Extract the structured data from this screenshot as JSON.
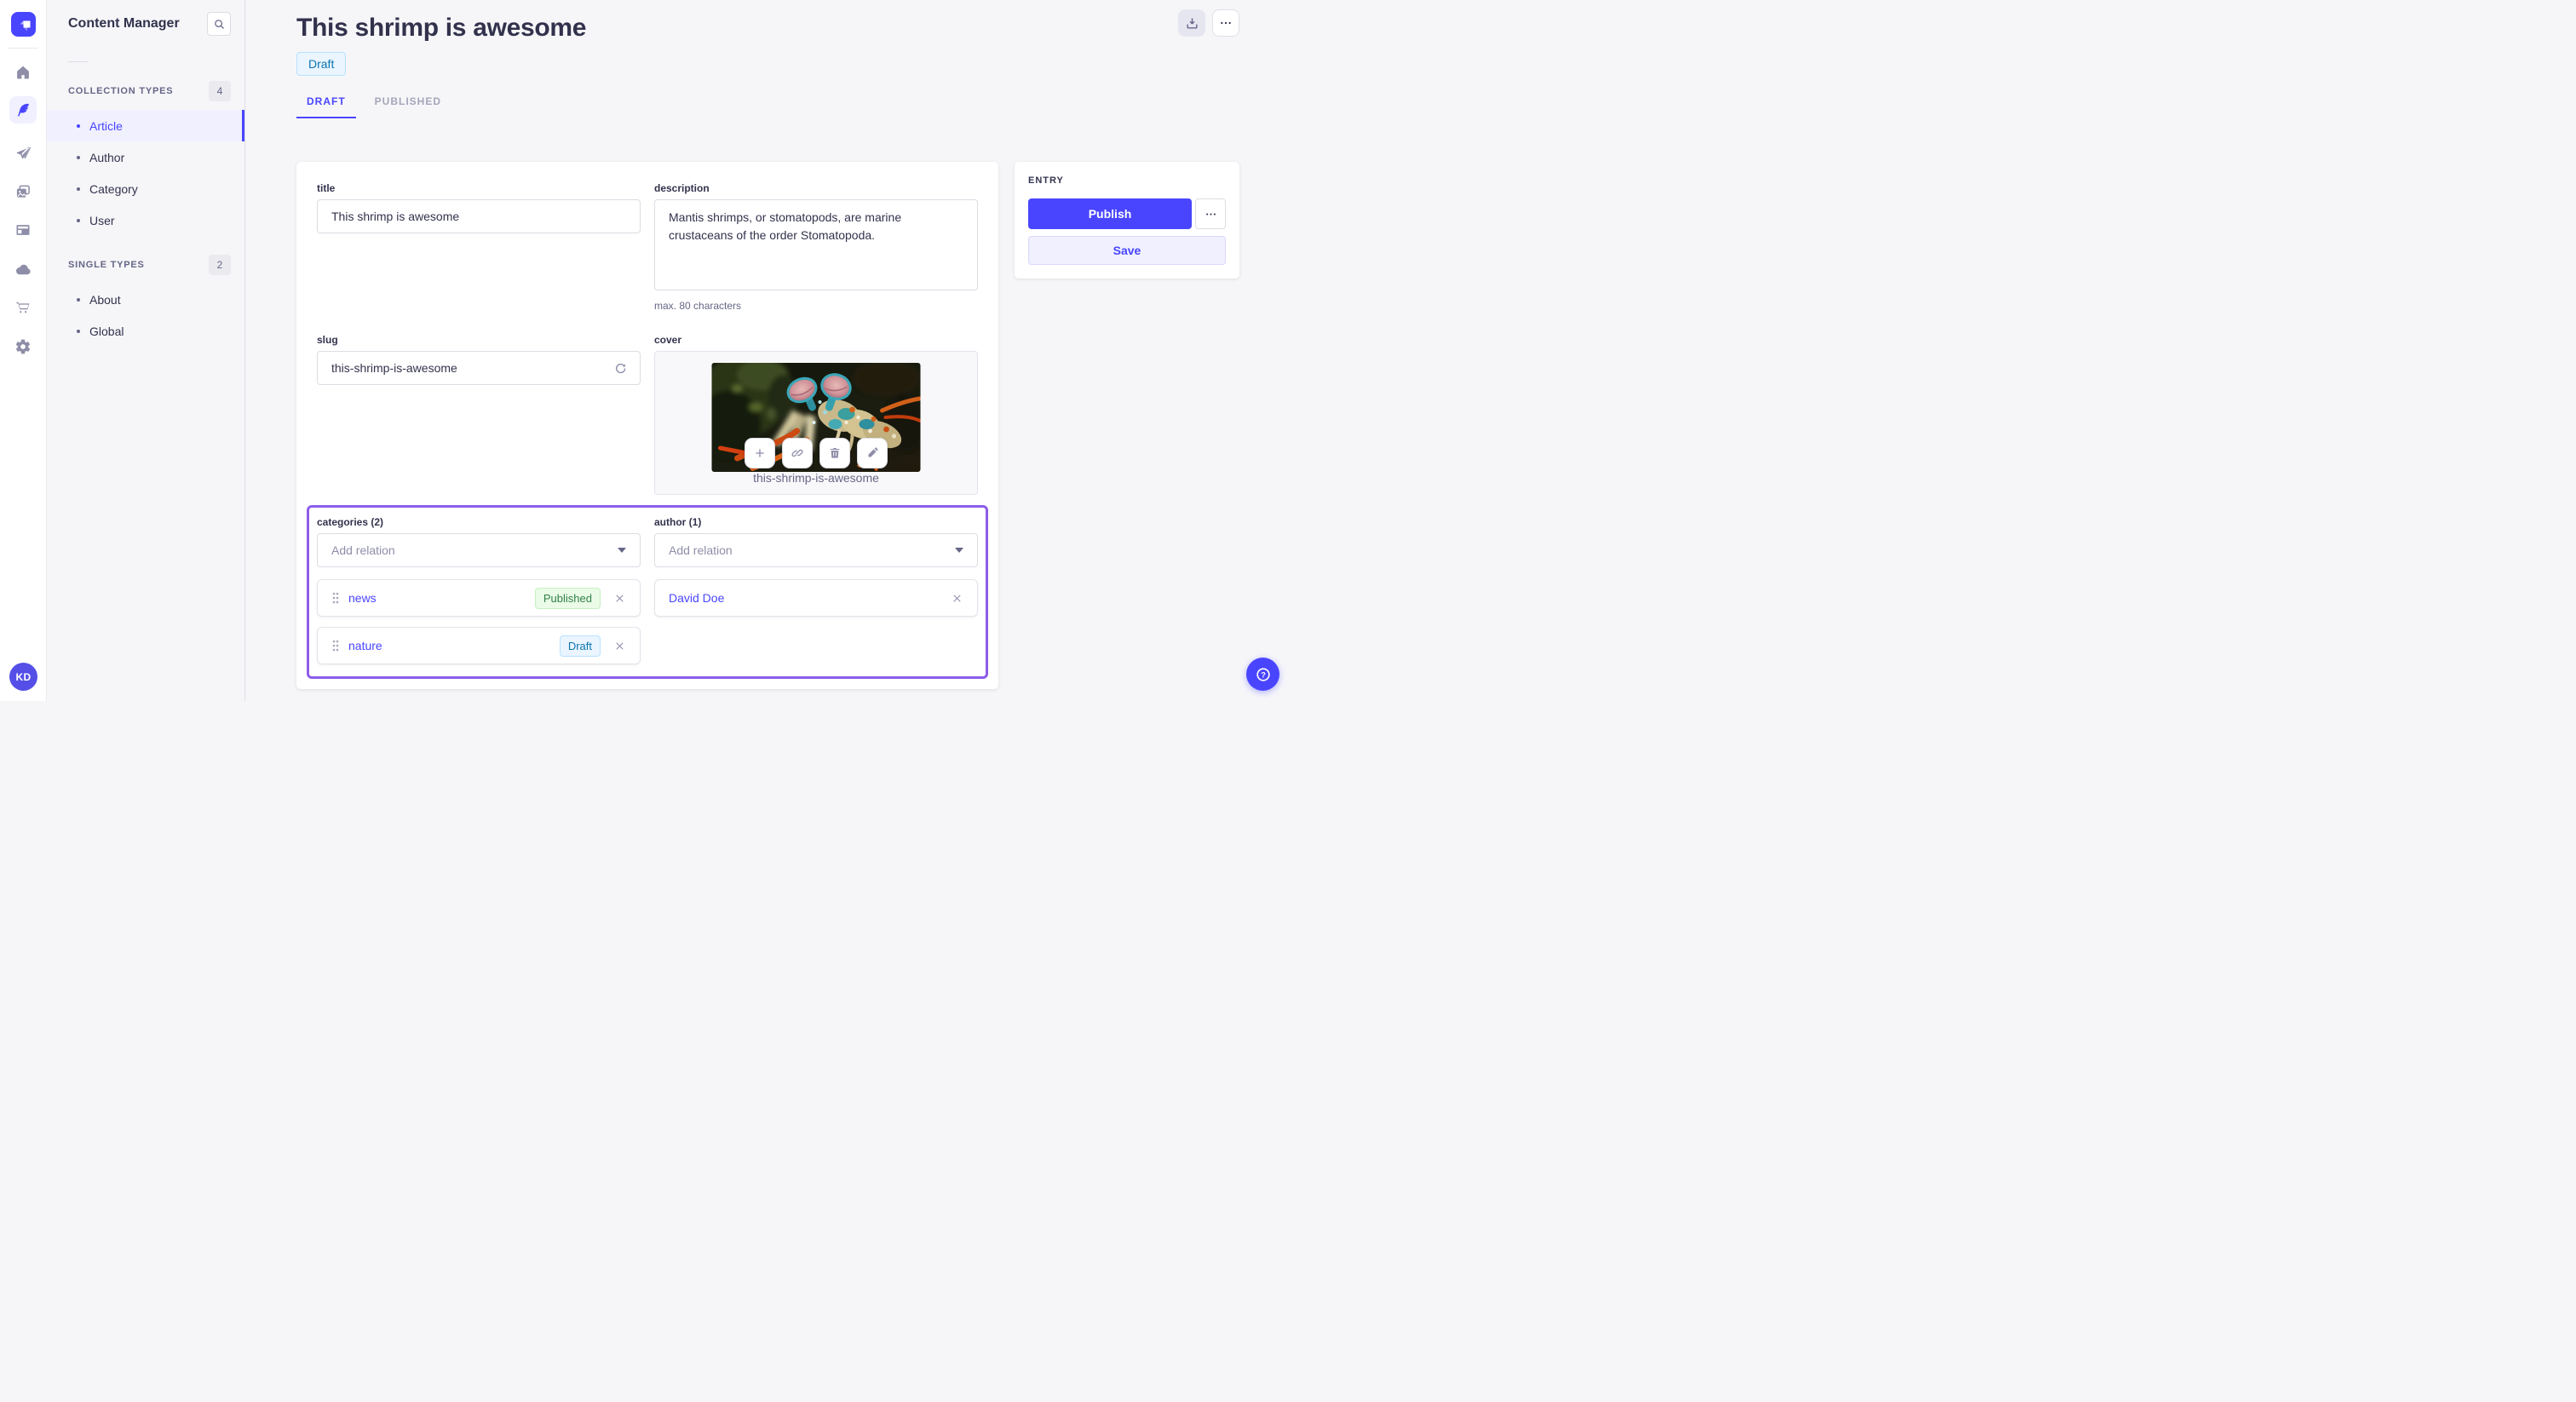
{
  "navbar": {
    "logo_icon": "strapi-logo",
    "items": [
      {
        "icon": "home-icon",
        "active": false
      },
      {
        "icon": "feather-icon",
        "active": true
      },
      {
        "icon": "send-icon",
        "active": false
      },
      {
        "icon": "media-icon",
        "active": false
      },
      {
        "icon": "layout-icon",
        "active": false
      },
      {
        "icon": "cloud-icon",
        "active": false
      },
      {
        "icon": "cart-icon",
        "active": false
      },
      {
        "icon": "gear-icon",
        "active": false
      }
    ],
    "avatar_initials": "KD"
  },
  "subnav": {
    "title": "Content Manager",
    "search_icon": "search-icon",
    "sections": [
      {
        "label": "COLLECTION TYPES",
        "count": "4",
        "items": [
          {
            "label": "Article",
            "active": true
          },
          {
            "label": "Author",
            "active": false
          },
          {
            "label": "Category",
            "active": false
          },
          {
            "label": "User",
            "active": false
          }
        ]
      },
      {
        "label": "SINGLE TYPES",
        "count": "2",
        "items": [
          {
            "label": "About",
            "active": false
          },
          {
            "label": "Global",
            "active": false
          }
        ]
      }
    ]
  },
  "header": {
    "title": "This shrimp is awesome",
    "status_badge": "Draft",
    "tabs": [
      {
        "label": "DRAFT",
        "active": true
      },
      {
        "label": "PUBLISHED",
        "active": false
      }
    ],
    "action_icons": [
      "download-icon",
      "more-icon"
    ]
  },
  "form": {
    "title": {
      "label": "title",
      "value": "This shrimp is awesome"
    },
    "description": {
      "label": "description",
      "value": "Mantis shrimps, or stomatopods, are marine crustaceans of the order Stomatopoda.",
      "hint": "max. 80 characters"
    },
    "slug": {
      "label": "slug",
      "value": "this-shrimp-is-awesome",
      "action_icon": "regenerate-icon"
    },
    "cover": {
      "label": "cover",
      "caption": "this-shrimp-is-awesome",
      "action_icons": [
        "plus-icon",
        "link-icon",
        "trash-icon",
        "pencil-icon"
      ]
    },
    "categories": {
      "label": "categories (2)",
      "placeholder": "Add relation",
      "items": [
        {
          "name": "news",
          "status": "Published"
        },
        {
          "name": "nature",
          "status": "Draft"
        }
      ]
    },
    "author": {
      "label": "author (1)",
      "placeholder": "Add relation",
      "items": [
        {
          "name": "David Doe"
        }
      ]
    }
  },
  "entry_panel": {
    "heading": "ENTRY",
    "publish_label": "Publish",
    "save_label": "Save",
    "more_icon": "more-icon"
  },
  "help": {
    "icon": "question-icon"
  },
  "colors": {
    "accent": "#4945ff",
    "active_bg": "#f0f0ff",
    "draft_bg": "#eaf5ff",
    "draft_border": "#b8e1ff",
    "draft_text": "#0c75af",
    "published_bg": "#eafbe7",
    "published_border": "#c6f0c2",
    "published_text": "#328048",
    "relation_outline": "#8e5cea"
  }
}
